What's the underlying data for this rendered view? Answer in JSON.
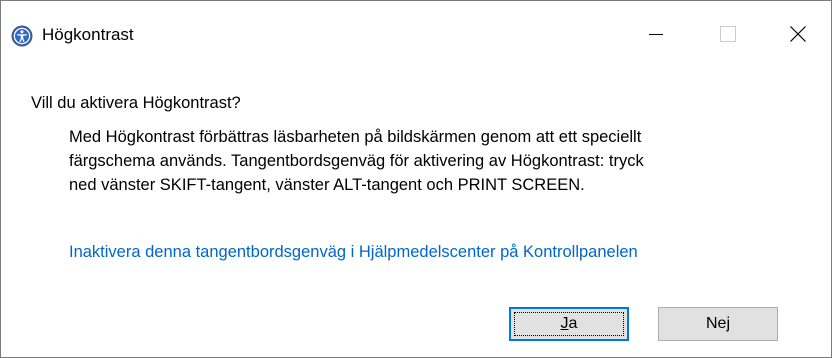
{
  "window": {
    "title": "Högkontrast",
    "icon": "accessibility-icon",
    "controls": [
      "minimize-icon",
      "maximize-icon",
      "close-icon"
    ]
  },
  "dialog": {
    "question": "Vill du aktivera Högkontrast?",
    "description_lines": [
      "Med Högkontrast förbättras läsbarheten på bildskärmen genom att ett speciellt",
      "färgschema används. Tangentbordsgenväg för aktivering av Högkontrast: tryck",
      "ned vänster SKIFT-tangent, vänster ALT-tangent och PRINT SCREEN."
    ],
    "link": "Inaktivera denna tangentbordsgenväg i Hjälpmedelscenter på Kontrollpanelen"
  },
  "buttons": {
    "yes": {
      "mnemonic": "J",
      "rest": "a"
    },
    "no": {
      "lead": "Ne",
      "mnemonic": "j"
    }
  },
  "colors": {
    "link": "#0066cc",
    "focus_border": "#0078d7",
    "button_bg": "#e1e1e1"
  }
}
